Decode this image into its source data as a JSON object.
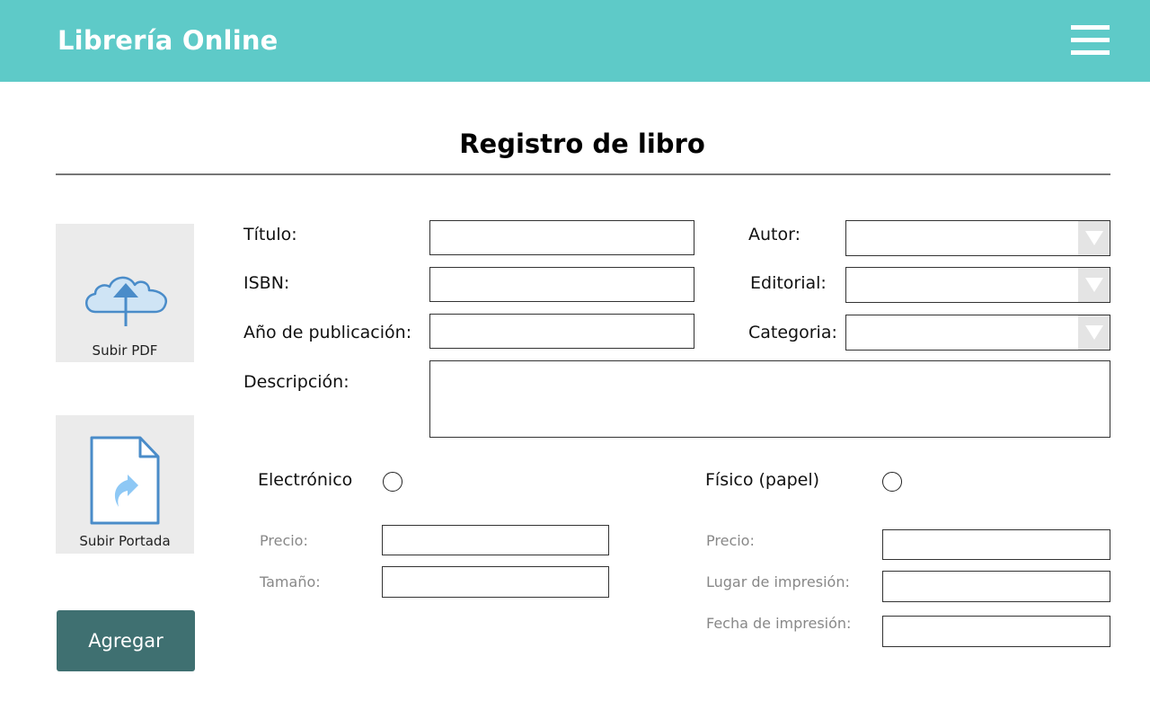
{
  "header": {
    "app_title": "Librería Online",
    "menu_icon": "hamburger-menu-icon",
    "background_color": "#5ecac8"
  },
  "page": {
    "title": "Registro de libro"
  },
  "uploads": {
    "pdf": {
      "label": "Subir PDF",
      "icon": "cloud-upload-icon"
    },
    "cover": {
      "label": "Subir Portada",
      "icon": "file-share-icon"
    }
  },
  "actions": {
    "add_label": "Agregar",
    "add_color": "#3f7071"
  },
  "form": {
    "titulo_label": "Título:",
    "titulo_value": "",
    "isbn_label": "ISBN:",
    "isbn_value": "",
    "anio_label": "Año de publicación:",
    "anio_value": "",
    "autor_label": "Autor:",
    "autor_value": "",
    "editorial_label": "Editorial:",
    "editorial_value": "",
    "categoria_label": "Categoria:",
    "categoria_value": "",
    "descripcion_label": "Descripción:",
    "descripcion_value": ""
  },
  "electronic": {
    "option_label": "Electrónico",
    "selected": false,
    "precio_label": "Precio:",
    "precio_value": "",
    "tamano_label": "Tamaño:",
    "tamano_value": ""
  },
  "physical": {
    "option_label": "Físico (papel)",
    "selected": false,
    "precio_label": "Precio:",
    "precio_value": "",
    "lugar_label": "Lugar de impresión:",
    "lugar_value": "",
    "fecha_label": "Fecha de impresión:",
    "fecha_value": ""
  }
}
